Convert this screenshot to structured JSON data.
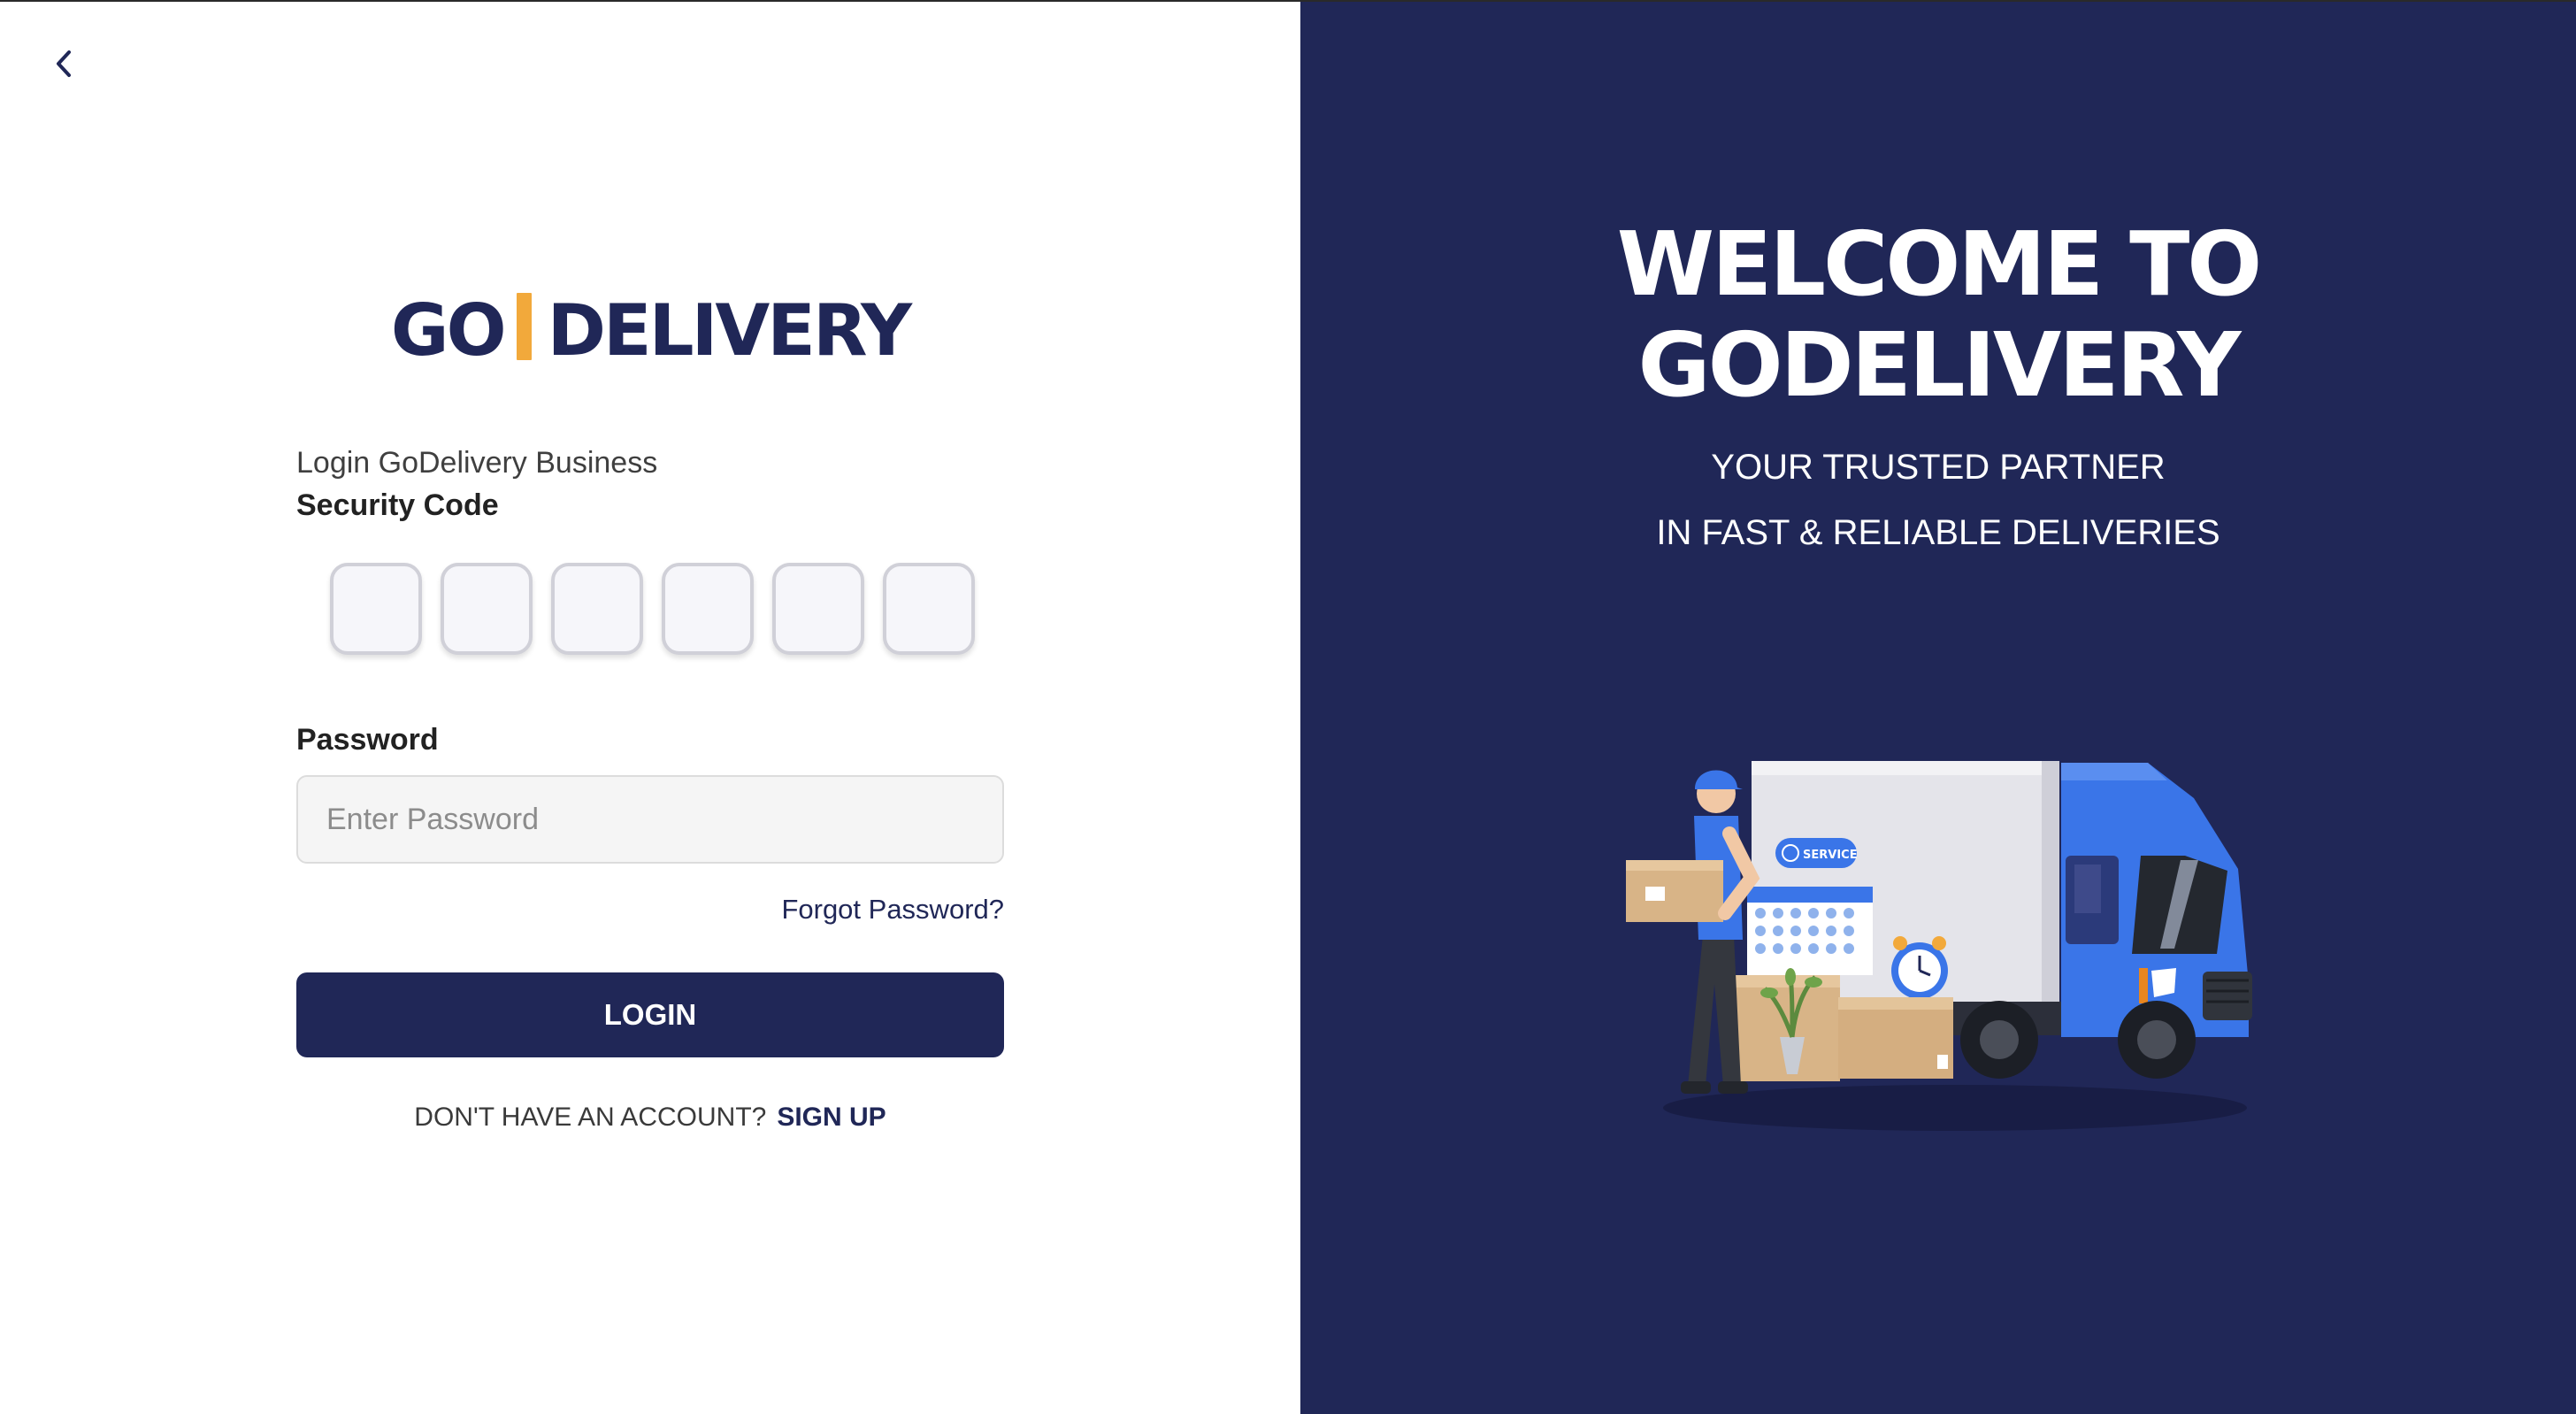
{
  "login_panel": {
    "logo": {
      "left": "GO",
      "right": "DELIVERY"
    },
    "subtitle": "Login GoDelivery Business",
    "security_code_label": "Security Code",
    "code_digits": [
      "",
      "",
      "",
      "",
      "",
      ""
    ],
    "password_label": "Password",
    "password_placeholder": "Enter Password",
    "forgot_password": "Forgot Password?",
    "login_button": "LOGIN",
    "no_account_text": "DON'T HAVE AN ACCOUNT?",
    "signup_link": "SIGN UP"
  },
  "welcome_panel": {
    "title_line1": "WELCOME TO",
    "title_line2": "GODELIVERY",
    "tagline_line1": "YOUR TRUSTED PARTNER",
    "tagline_line2": "IN FAST & RELIABLE DELIVERIES",
    "truck_badge": "SERVICE"
  },
  "colors": {
    "brand_navy": "#202757",
    "accent_orange": "#f2a93b",
    "truck_blue": "#3a75e8"
  },
  "icons": [
    "back-chevron-icon"
  ]
}
